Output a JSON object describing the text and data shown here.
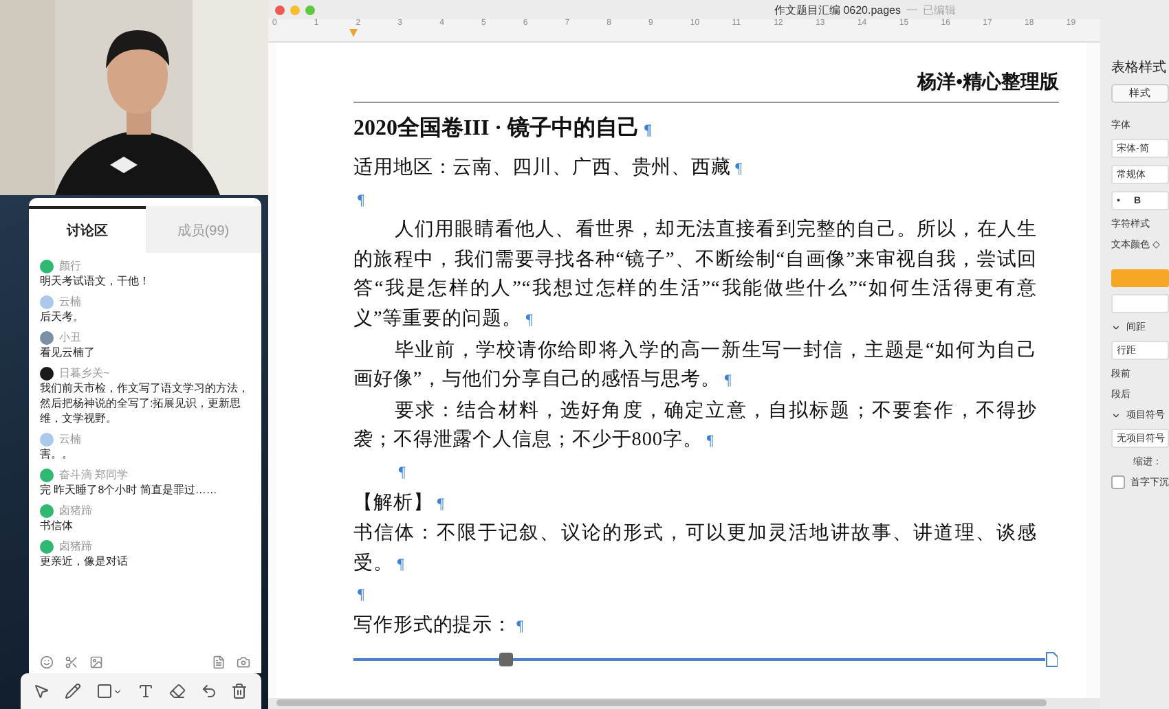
{
  "chat": {
    "tabs": [
      {
        "label": "讨论区",
        "selected": true
      },
      {
        "label": "成员(99)",
        "selected": false
      }
    ],
    "messages": [
      {
        "name": "颜行",
        "text": "明天考试语文，干他！",
        "color": "#2fb872"
      },
      {
        "name": "云楠",
        "text": "后天考。",
        "color": "#a9c8ec"
      },
      {
        "name": "小丑",
        "text": "看见云楠了",
        "color": "#7d8fa6"
      },
      {
        "name": "日暮乡关~",
        "text": "我们前天市检，作文写了语文学习的方法，然后把杨神说的全写了:拓展见识，更新思维，文学视野。",
        "color": "#1a1a1a"
      },
      {
        "name": "云楠",
        "text": "害。。",
        "color": "#a9c8ec"
      },
      {
        "name": "奋斗滴 郑同学",
        "text": "完 昨天睡了8个小时 简直是罪过……",
        "color": "#2fb872"
      },
      {
        "name": "卤猪蹄",
        "text": "书信体",
        "color": "#2fb872"
      },
      {
        "name": "卤猪蹄",
        "text": "更亲近，像是对话",
        "color": "#2fb872"
      }
    ]
  },
  "document": {
    "window_title": "作文题目汇编 0620.pages",
    "separator": "—",
    "status": "已编辑",
    "ruler": [
      "0",
      "1",
      "2",
      "3",
      "4",
      "5",
      "6",
      "7",
      "8",
      "9",
      "10",
      "11",
      "12",
      "13",
      "14",
      "15",
      "16",
      "17",
      "18",
      "19"
    ],
    "header": "杨洋•精心整理版",
    "paragraphs": [
      {
        "kind": "title",
        "text": "2020全国卷III · 镜子中的自己",
        "mark": "¶"
      },
      {
        "kind": "body",
        "text": "适用地区：云南、四川、广西、贵州、西藏",
        "mark": "¶",
        "indent": false
      },
      {
        "kind": "body",
        "mark": "¶",
        "indent": false
      },
      {
        "kind": "body",
        "text": "人们用眼睛看他人、看世界，却无法直接看到完整的自己。所以，在人生的旅程中，我们需要寻找各种“镜子”、不断绘制“自画像”来审视自我，尝试回答“我是怎样的人”“我想过怎样的生活”“我能做些什么”“如何生活得更有意义”等重要的问题。",
        "mark": "¶",
        "indent": true
      },
      {
        "kind": "body",
        "text": "毕业前，学校请你给即将入学的高一新生写一封信，主题是“如何为自己画好像”，与他们分享自己的感悟与思考。",
        "mark": "¶",
        "indent": true
      },
      {
        "kind": "body",
        "text": "要求：结合材料，选好角度，确定立意，自拟标题；不要套作，不得抄袭；不得泄露个人信息；不少于800字。",
        "mark": "¶",
        "indent": true
      },
      {
        "kind": "body",
        "mark": "¶",
        "indent": true
      },
      {
        "kind": "body",
        "text": "【解析】",
        "mark": "¶",
        "indent": false
      },
      {
        "kind": "body",
        "text": "书信体：不限于记叙、议论的形式，可以更加灵活地讲故事、讲道理、谈感受。",
        "mark": "¶",
        "indent": false
      },
      {
        "kind": "body",
        "mark": "¶",
        "indent": false
      },
      {
        "kind": "body",
        "text": "写作形式的提示：",
        "mark": "¶",
        "indent": false
      }
    ]
  },
  "inspector": {
    "title": "表格样式",
    "style_button": "样式",
    "font_label": "字体",
    "font_family": "宋体-简",
    "font_weight": "常规体",
    "size_dot": "•",
    "bold": "B",
    "char_style": "字符样式",
    "text_color": "文本颜色 ◇",
    "spacing": "间距",
    "line_spacing": "行距",
    "before": "段前",
    "after": "段后",
    "bullets": "项目符号",
    "bullets_value": "无项目符号",
    "indent": "缩进：",
    "drop_cap": {
      "label": "首字下沉",
      "checked": false
    }
  }
}
